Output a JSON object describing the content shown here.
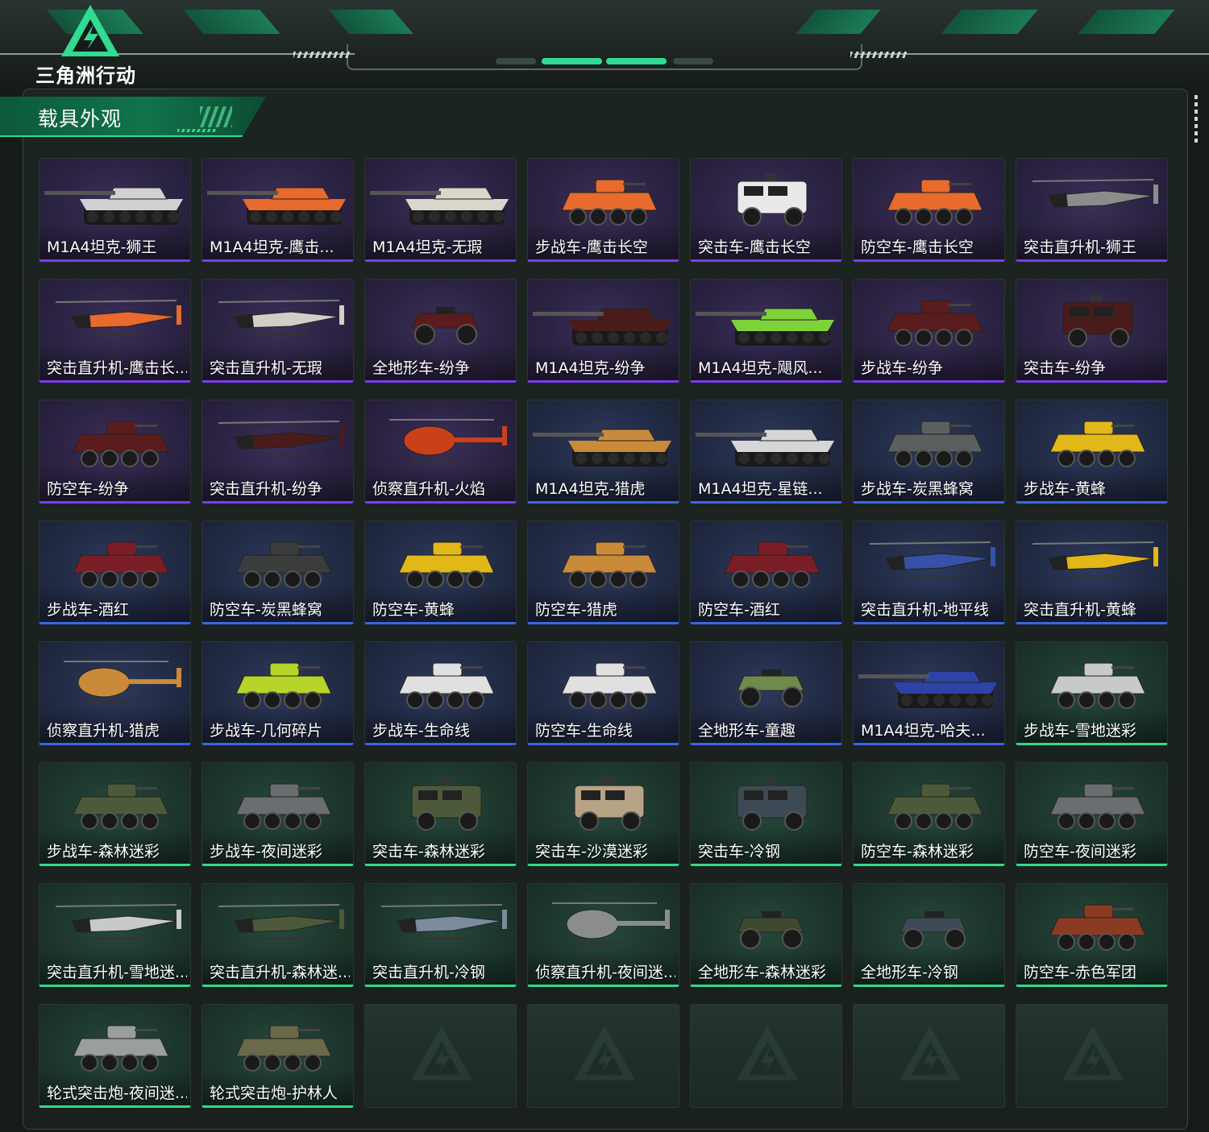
{
  "app": {
    "logo_text": "三角洲行动"
  },
  "panel": {
    "title": "载具外观"
  },
  "items": [
    {
      "label": "M1A4坦克-狮王",
      "rarity": "purple",
      "icon": "tank-icon",
      "color": "#cfd2d0"
    },
    {
      "label": "M1A4坦克-鹰击...",
      "rarity": "purple",
      "icon": "tank-icon",
      "color": "#e86a2c"
    },
    {
      "label": "M1A4坦克-无瑕",
      "rarity": "purple",
      "icon": "tank-icon",
      "color": "#d9d7cc"
    },
    {
      "label": "步战车-鹰击长空",
      "rarity": "purple",
      "icon": "ifv-icon",
      "color": "#e86a2c"
    },
    {
      "label": "突击车-鹰击长空",
      "rarity": "purple",
      "icon": "assault-vehicle-icon",
      "color": "#e9e9e9"
    },
    {
      "label": "防空车-鹰击长空",
      "rarity": "purple",
      "icon": "ifv-icon",
      "color": "#e86a2c"
    },
    {
      "label": "突击直升机-狮王",
      "rarity": "purple",
      "icon": "helicopter-icon",
      "color": "#8a8d8c"
    },
    {
      "label": "突击直升机-鹰击长...",
      "rarity": "purple",
      "icon": "helicopter-icon",
      "color": "#e86a2c"
    },
    {
      "label": "突击直升机-无瑕",
      "rarity": "purple",
      "icon": "helicopter-icon",
      "color": "#cfcfc8"
    },
    {
      "label": "全地形车-纷争",
      "rarity": "purple",
      "icon": "atv-icon",
      "color": "#5a1c1c"
    },
    {
      "label": "M1A4坦克-纷争",
      "rarity": "purple",
      "icon": "tank-icon",
      "color": "#4a1b1b"
    },
    {
      "label": "M1A4坦克-飓风...",
      "rarity": "purple",
      "icon": "tank-icon",
      "color": "#7ed23a"
    },
    {
      "label": "步战车-纷争",
      "rarity": "purple",
      "icon": "ifv-icon",
      "color": "#5a1c1c"
    },
    {
      "label": "突击车-纷争",
      "rarity": "purple",
      "icon": "assault-vehicle-icon",
      "color": "#4a1b1b"
    },
    {
      "label": "防空车-纷争",
      "rarity": "purple",
      "icon": "ifv-icon",
      "color": "#5a1c1c"
    },
    {
      "label": "突击直升机-纷争",
      "rarity": "purple",
      "icon": "helicopter-icon",
      "color": "#4a1b1b"
    },
    {
      "label": "侦察直升机-火焰",
      "rarity": "purple",
      "icon": "scout-helicopter-icon",
      "color": "#c9411b"
    },
    {
      "label": "M1A4坦克-猎虎",
      "rarity": "blue",
      "icon": "tank-icon",
      "color": "#c98a3a"
    },
    {
      "label": "M1A4坦克-星链...",
      "rarity": "blue",
      "icon": "tank-icon",
      "color": "#d6d6d6"
    },
    {
      "label": "步战车-炭黑蜂窝",
      "rarity": "blue",
      "icon": "ifv-icon",
      "color": "#5b5f5e"
    },
    {
      "label": "步战车-黄蜂",
      "rarity": "blue",
      "icon": "ifv-icon",
      "color": "#e2b718"
    },
    {
      "label": "步战车-酒红",
      "rarity": "blue",
      "icon": "ifv-icon",
      "color": "#7a1d27"
    },
    {
      "label": "防空车-炭黑蜂窝",
      "rarity": "blue",
      "icon": "ifv-icon",
      "color": "#3a3d3c"
    },
    {
      "label": "防空车-黄蜂",
      "rarity": "blue",
      "icon": "ifv-icon",
      "color": "#e2b718"
    },
    {
      "label": "防空车-猎虎",
      "rarity": "blue",
      "icon": "ifv-icon",
      "color": "#c98a3a"
    },
    {
      "label": "防空车-酒红",
      "rarity": "blue",
      "icon": "ifv-icon",
      "color": "#7a1d27"
    },
    {
      "label": "突击直升机-地平线",
      "rarity": "blue",
      "icon": "helicopter-icon",
      "color": "#3552a8"
    },
    {
      "label": "突击直升机-黄蜂",
      "rarity": "blue",
      "icon": "helicopter-icon",
      "color": "#e2b718"
    },
    {
      "label": "侦察直升机-猎虎",
      "rarity": "blue",
      "icon": "scout-helicopter-icon",
      "color": "#c98a3a"
    },
    {
      "label": "步战车-几何碎片",
      "rarity": "blue",
      "icon": "ifv-icon",
      "color": "#b6d42a"
    },
    {
      "label": "步战车-生命线",
      "rarity": "blue",
      "icon": "ifv-icon",
      "color": "#e0e0e0"
    },
    {
      "label": "防空车-生命线",
      "rarity": "blue",
      "icon": "ifv-icon",
      "color": "#e0e0e0"
    },
    {
      "label": "全地形车-童趣",
      "rarity": "blue",
      "icon": "atv-icon",
      "color": "#6f8a4a"
    },
    {
      "label": "M1A4坦克-哈夫...",
      "rarity": "blue",
      "icon": "tank-icon",
      "color": "#2e43a6"
    },
    {
      "label": "步战车-雪地迷彩",
      "rarity": "green",
      "icon": "ifv-icon",
      "color": "#c8cac8"
    },
    {
      "label": "步战车-森林迷彩",
      "rarity": "green",
      "icon": "ifv-icon",
      "color": "#4d5a3a"
    },
    {
      "label": "步战车-夜间迷彩",
      "rarity": "green",
      "icon": "ifv-icon",
      "color": "#6a6e70"
    },
    {
      "label": "突击车-森林迷彩",
      "rarity": "green",
      "icon": "assault-vehicle-icon",
      "color": "#4d5a3a"
    },
    {
      "label": "突击车-沙漠迷彩",
      "rarity": "green",
      "icon": "assault-vehicle-icon",
      "color": "#b7a487"
    },
    {
      "label": "突击车-冷钢",
      "rarity": "green",
      "icon": "assault-vehicle-icon",
      "color": "#3d4a55"
    },
    {
      "label": "防空车-森林迷彩",
      "rarity": "green",
      "icon": "ifv-icon",
      "color": "#4d5a3a"
    },
    {
      "label": "防空车-夜间迷彩",
      "rarity": "green",
      "icon": "ifv-icon",
      "color": "#6a6e70"
    },
    {
      "label": "突击直升机-雪地迷...",
      "rarity": "green",
      "icon": "helicopter-icon",
      "color": "#c8cac8"
    },
    {
      "label": "突击直升机-森林迷...",
      "rarity": "green",
      "icon": "helicopter-icon",
      "color": "#4d5a3a"
    },
    {
      "label": "突击直升机-冷钢",
      "rarity": "green",
      "icon": "helicopter-icon",
      "color": "#7b8a9c"
    },
    {
      "label": "侦察直升机-夜间迷...",
      "rarity": "green",
      "icon": "scout-helicopter-icon",
      "color": "#8a8d8c"
    },
    {
      "label": "全地形车-森林迷彩",
      "rarity": "green",
      "icon": "atv-icon",
      "color": "#3d4a30"
    },
    {
      "label": "全地形车-冷钢",
      "rarity": "green",
      "icon": "atv-icon",
      "color": "#3d4a55"
    },
    {
      "label": "防空车-赤色军团",
      "rarity": "green",
      "icon": "ifv-icon",
      "color": "#8a3a22"
    },
    {
      "label": "轮式突击炮-夜间迷...",
      "rarity": "green",
      "icon": "wheeled-assault-gun-icon",
      "color": "#9a9e9c"
    },
    {
      "label": "轮式突击炮-护林人",
      "rarity": "green",
      "icon": "wheeled-assault-gun-icon",
      "color": "#6a6a4a"
    },
    {
      "label": "",
      "rarity": "empty",
      "icon": "logo-placeholder-icon",
      "color": ""
    },
    {
      "label": "",
      "rarity": "empty",
      "icon": "logo-placeholder-icon",
      "color": ""
    },
    {
      "label": "",
      "rarity": "empty",
      "icon": "logo-placeholder-icon",
      "color": ""
    },
    {
      "label": "",
      "rarity": "empty",
      "icon": "logo-placeholder-icon",
      "color": ""
    },
    {
      "label": "",
      "rarity": "empty",
      "icon": "logo-placeholder-icon",
      "color": ""
    }
  ],
  "colors": {
    "purple_rarity": "#7a3df0",
    "blue_rarity": "#3a66e6",
    "green_rarity": "#35d889",
    "accent_green": "#2fdc92"
  }
}
